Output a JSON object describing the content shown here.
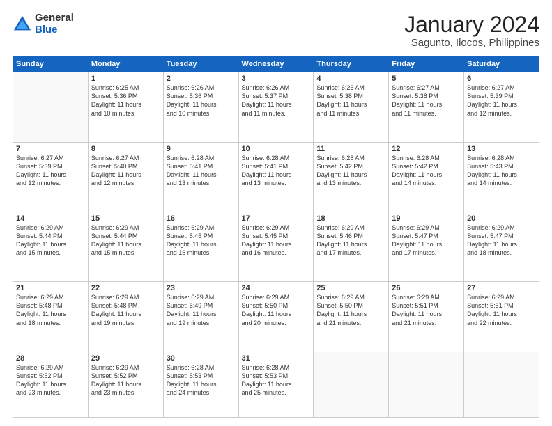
{
  "logo": {
    "general": "General",
    "blue": "Blue"
  },
  "title": "January 2024",
  "location": "Sagunto, Ilocos, Philippines",
  "headers": [
    "Sunday",
    "Monday",
    "Tuesday",
    "Wednesday",
    "Thursday",
    "Friday",
    "Saturday"
  ],
  "weeks": [
    [
      {
        "day": "",
        "info": ""
      },
      {
        "day": "1",
        "info": "Sunrise: 6:25 AM\nSunset: 5:36 PM\nDaylight: 11 hours\nand 10 minutes."
      },
      {
        "day": "2",
        "info": "Sunrise: 6:26 AM\nSunset: 5:36 PM\nDaylight: 11 hours\nand 10 minutes."
      },
      {
        "day": "3",
        "info": "Sunrise: 6:26 AM\nSunset: 5:37 PM\nDaylight: 11 hours\nand 11 minutes."
      },
      {
        "day": "4",
        "info": "Sunrise: 6:26 AM\nSunset: 5:38 PM\nDaylight: 11 hours\nand 11 minutes."
      },
      {
        "day": "5",
        "info": "Sunrise: 6:27 AM\nSunset: 5:38 PM\nDaylight: 11 hours\nand 11 minutes."
      },
      {
        "day": "6",
        "info": "Sunrise: 6:27 AM\nSunset: 5:39 PM\nDaylight: 11 hours\nand 12 minutes."
      }
    ],
    [
      {
        "day": "7",
        "info": "Sunrise: 6:27 AM\nSunset: 5:39 PM\nDaylight: 11 hours\nand 12 minutes."
      },
      {
        "day": "8",
        "info": "Sunrise: 6:27 AM\nSunset: 5:40 PM\nDaylight: 11 hours\nand 12 minutes."
      },
      {
        "day": "9",
        "info": "Sunrise: 6:28 AM\nSunset: 5:41 PM\nDaylight: 11 hours\nand 13 minutes."
      },
      {
        "day": "10",
        "info": "Sunrise: 6:28 AM\nSunset: 5:41 PM\nDaylight: 11 hours\nand 13 minutes."
      },
      {
        "day": "11",
        "info": "Sunrise: 6:28 AM\nSunset: 5:42 PM\nDaylight: 11 hours\nand 13 minutes."
      },
      {
        "day": "12",
        "info": "Sunrise: 6:28 AM\nSunset: 5:42 PM\nDaylight: 11 hours\nand 14 minutes."
      },
      {
        "day": "13",
        "info": "Sunrise: 6:28 AM\nSunset: 5:43 PM\nDaylight: 11 hours\nand 14 minutes."
      }
    ],
    [
      {
        "day": "14",
        "info": "Sunrise: 6:29 AM\nSunset: 5:44 PM\nDaylight: 11 hours\nand 15 minutes."
      },
      {
        "day": "15",
        "info": "Sunrise: 6:29 AM\nSunset: 5:44 PM\nDaylight: 11 hours\nand 15 minutes."
      },
      {
        "day": "16",
        "info": "Sunrise: 6:29 AM\nSunset: 5:45 PM\nDaylight: 11 hours\nand 16 minutes."
      },
      {
        "day": "17",
        "info": "Sunrise: 6:29 AM\nSunset: 5:45 PM\nDaylight: 11 hours\nand 16 minutes."
      },
      {
        "day": "18",
        "info": "Sunrise: 6:29 AM\nSunset: 5:46 PM\nDaylight: 11 hours\nand 17 minutes."
      },
      {
        "day": "19",
        "info": "Sunrise: 6:29 AM\nSunset: 5:47 PM\nDaylight: 11 hours\nand 17 minutes."
      },
      {
        "day": "20",
        "info": "Sunrise: 6:29 AM\nSunset: 5:47 PM\nDaylight: 11 hours\nand 18 minutes."
      }
    ],
    [
      {
        "day": "21",
        "info": "Sunrise: 6:29 AM\nSunset: 5:48 PM\nDaylight: 11 hours\nand 18 minutes."
      },
      {
        "day": "22",
        "info": "Sunrise: 6:29 AM\nSunset: 5:48 PM\nDaylight: 11 hours\nand 19 minutes."
      },
      {
        "day": "23",
        "info": "Sunrise: 6:29 AM\nSunset: 5:49 PM\nDaylight: 11 hours\nand 19 minutes."
      },
      {
        "day": "24",
        "info": "Sunrise: 6:29 AM\nSunset: 5:50 PM\nDaylight: 11 hours\nand 20 minutes."
      },
      {
        "day": "25",
        "info": "Sunrise: 6:29 AM\nSunset: 5:50 PM\nDaylight: 11 hours\nand 21 minutes."
      },
      {
        "day": "26",
        "info": "Sunrise: 6:29 AM\nSunset: 5:51 PM\nDaylight: 11 hours\nand 21 minutes."
      },
      {
        "day": "27",
        "info": "Sunrise: 6:29 AM\nSunset: 5:51 PM\nDaylight: 11 hours\nand 22 minutes."
      }
    ],
    [
      {
        "day": "28",
        "info": "Sunrise: 6:29 AM\nSunset: 5:52 PM\nDaylight: 11 hours\nand 23 minutes."
      },
      {
        "day": "29",
        "info": "Sunrise: 6:29 AM\nSunset: 5:52 PM\nDaylight: 11 hours\nand 23 minutes."
      },
      {
        "day": "30",
        "info": "Sunrise: 6:28 AM\nSunset: 5:53 PM\nDaylight: 11 hours\nand 24 minutes."
      },
      {
        "day": "31",
        "info": "Sunrise: 6:28 AM\nSunset: 5:53 PM\nDaylight: 11 hours\nand 25 minutes."
      },
      {
        "day": "",
        "info": ""
      },
      {
        "day": "",
        "info": ""
      },
      {
        "day": "",
        "info": ""
      }
    ]
  ]
}
